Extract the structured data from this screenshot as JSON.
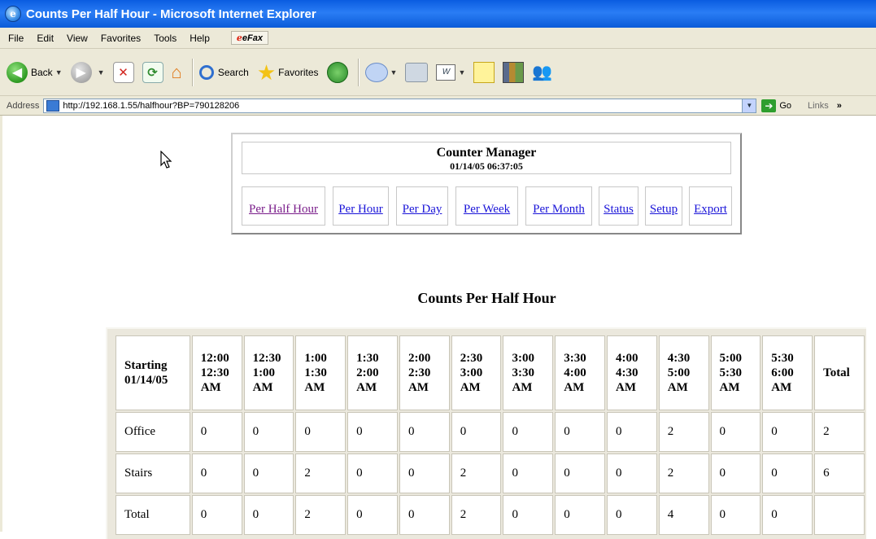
{
  "window": {
    "title": "Counts Per Half Hour - Microsoft Internet Explorer",
    "icon": "ie-logo-icon"
  },
  "menu": [
    "File",
    "Edit",
    "View",
    "Favorites",
    "Tools",
    "Help"
  ],
  "efax_label": "eFax",
  "toolbar": {
    "back": "Back",
    "search": "Search",
    "favorites": "Favorites"
  },
  "address": {
    "label": "Address",
    "url": "http://192.168.1.55/halfhour?BP=790128206",
    "go": "Go",
    "links": "Links",
    "more": "»"
  },
  "app": {
    "name": "Counter Manager",
    "datetime": "01/14/05 06:37:05"
  },
  "nav": [
    {
      "label": "Per Half Hour",
      "visited": true
    },
    {
      "label": "Per Hour"
    },
    {
      "label": "Per Day"
    },
    {
      "label": "Per Week"
    },
    {
      "label": "Per Month"
    },
    {
      "label": "Status"
    },
    {
      "label": "Setup"
    },
    {
      "label": "Export"
    }
  ],
  "heading": "Counts Per Half Hour",
  "table": {
    "corner": [
      "Starting",
      "01/14/05"
    ],
    "columns": [
      [
        "12:00",
        "12:30",
        "AM"
      ],
      [
        "12:30",
        "1:00",
        "AM"
      ],
      [
        "1:00",
        "1:30",
        "AM"
      ],
      [
        "1:30",
        "2:00",
        "AM"
      ],
      [
        "2:00",
        "2:30",
        "AM"
      ],
      [
        "2:30",
        "3:00",
        "AM"
      ],
      [
        "3:00",
        "3:30",
        "AM"
      ],
      [
        "3:30",
        "4:00",
        "AM"
      ],
      [
        "4:00",
        "4:30",
        "AM"
      ],
      [
        "4:30",
        "5:00",
        "AM"
      ],
      [
        "5:00",
        "5:30",
        "AM"
      ],
      [
        "5:30",
        "6:00",
        "AM"
      ]
    ],
    "total_label": "Total",
    "rows": [
      {
        "label": "Office",
        "values": [
          "0",
          "0",
          "0",
          "0",
          "0",
          "0",
          "0",
          "0",
          "0",
          "2",
          "0",
          "0"
        ],
        "total": "2"
      },
      {
        "label": "Stairs",
        "values": [
          "0",
          "0",
          "2",
          "0",
          "0",
          "2",
          "0",
          "0",
          "0",
          "2",
          "0",
          "0"
        ],
        "total": "6"
      },
      {
        "label": "Total",
        "values": [
          "0",
          "0",
          "2",
          "0",
          "0",
          "2",
          "0",
          "0",
          "0",
          "4",
          "0",
          "0"
        ],
        "total": ""
      }
    ]
  },
  "colors": {
    "link": "#1a14d8",
    "visited_link": "#7a1d8a",
    "titlebar": "#0a5ce0"
  }
}
